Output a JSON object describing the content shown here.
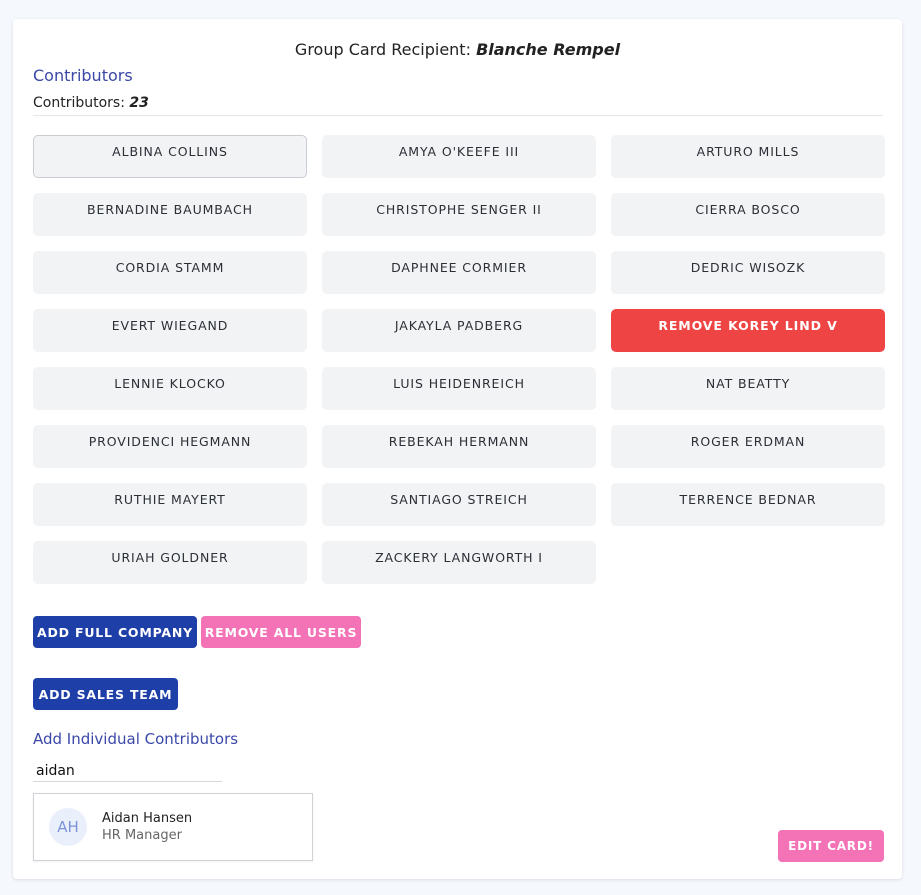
{
  "header": {
    "recipient_label": "Group Card Recipient:",
    "recipient_name": "Blanche Rempel"
  },
  "contributors": {
    "section_title": "Contributors",
    "count_label": "Contributors:",
    "count": "23",
    "names": [
      "ALBINA COLLINS",
      "AMYA O'KEEFE III",
      "ARTURO MILLS",
      "BERNADINE BAUMBACH",
      "CHRISTOPHE SENGER II",
      "CIERRA BOSCO",
      "CORDIA STAMM",
      "DAPHNEE CORMIER",
      "DEDRIC WISOZK",
      "EVERT WIEGAND",
      "JAKAYLA PADBERG",
      "REMOVE KOREY LIND V",
      "LENNIE KLOCKO",
      "LUIS HEIDENREICH",
      "NAT BEATTY",
      "PROVIDENCI HEGMANN",
      "REBEKAH HERMANN",
      "ROGER ERDMAN",
      "RUTHIE MAYERT",
      "SANTIAGO STREICH",
      "TERRENCE BEDNAR",
      "URIAH GOLDNER",
      "ZACKERY LANGWORTH I"
    ]
  },
  "actions": {
    "add_full_company": "ADD FULL COMPANY",
    "remove_all_users": "REMOVE ALL USERS",
    "add_sales_team": "ADD SALES TEAM"
  },
  "individual": {
    "section_title": "Add Individual Contributors",
    "search_value": "aidan",
    "result": {
      "initials": "AH",
      "name": "Aidan Hansen",
      "role": "HR Manager"
    }
  },
  "footer": {
    "edit_card": "EDIT CARD!"
  },
  "colors": {
    "primary": "#1e3fa8",
    "pink": "#f472b6",
    "danger": "#ef4444",
    "link": "#3b48a8"
  }
}
